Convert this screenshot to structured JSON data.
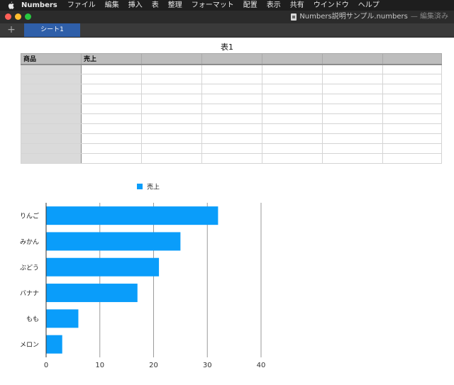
{
  "menubar": {
    "app_name": "Numbers",
    "items": [
      "ファイル",
      "編集",
      "挿入",
      "表",
      "整理",
      "フォーマット",
      "配置",
      "表示",
      "共有",
      "ウインドウ",
      "ヘルプ"
    ]
  },
  "window": {
    "document_title": "Numbers説明サンプル.numbers",
    "separator": " — ",
    "status": "編集済み"
  },
  "sheets": {
    "add_label": "+",
    "tabs": [
      "シート1"
    ]
  },
  "table": {
    "title": "表1",
    "headers": [
      "商品",
      "売上",
      "",
      "",
      "",
      "",
      ""
    ],
    "rows": [
      [
        "",
        "",
        "",
        "",
        "",
        "",
        ""
      ],
      [
        "",
        "",
        "",
        "",
        "",
        "",
        ""
      ],
      [
        "",
        "",
        "",
        "",
        "",
        "",
        ""
      ],
      [
        "",
        "",
        "",
        "",
        "",
        "",
        ""
      ],
      [
        "",
        "",
        "",
        "",
        "",
        "",
        ""
      ],
      [
        "",
        "",
        "",
        "",
        "",
        "",
        ""
      ],
      [
        "",
        "",
        "",
        "",
        "",
        "",
        ""
      ],
      [
        "",
        "",
        "",
        "",
        "",
        "",
        ""
      ],
      [
        "",
        "",
        "",
        "",
        "",
        "",
        ""
      ],
      [
        "",
        "",
        "",
        "",
        "",
        "",
        ""
      ]
    ]
  },
  "chart_data": {
    "type": "bar",
    "orientation": "horizontal",
    "categories": [
      "りんご",
      "みかん",
      "ぶどう",
      "バナナ",
      "もも",
      "メロン"
    ],
    "series": [
      {
        "name": "売上",
        "values": [
          32,
          25,
          21,
          17,
          6,
          3
        ],
        "color": "#0a9dfa"
      }
    ],
    "xlim": [
      0,
      40
    ],
    "xticks": [
      0,
      10,
      20,
      30,
      40
    ],
    "grid": true,
    "legend": "top"
  },
  "colors": {
    "bar": "#0a9dfa",
    "grid": "#9a9a9a",
    "axis": "#333333"
  }
}
